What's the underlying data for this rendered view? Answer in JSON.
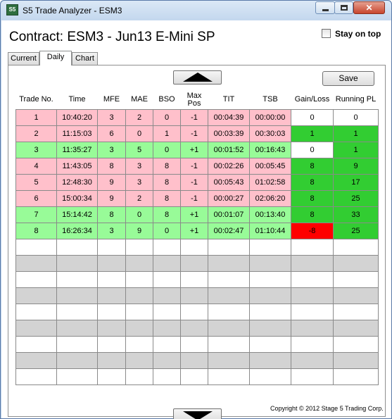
{
  "window": {
    "title": "S5 Trade Analyzer - ESM3",
    "icon_text": "S5"
  },
  "header": {
    "contract_label": "Contract: ESM3 - Jun13 E-Mini SP",
    "stay_on_top_label": "Stay on top",
    "stay_on_top_checked": false
  },
  "tabs": [
    {
      "label": "Current",
      "active": false
    },
    {
      "label": "Daily",
      "active": true
    },
    {
      "label": "Chart",
      "active": false
    }
  ],
  "toolbar": {
    "save_label": "Save",
    "scroll_up_icon": "triangle-up-icon",
    "scroll_down_icon": "triangle-down-icon"
  },
  "table": {
    "columns": [
      "Trade No.",
      "Time",
      "MFE",
      "MAE",
      "BSO",
      "Max\nPos",
      "TIT",
      "TSB",
      "Gain/Loss",
      "Running PL"
    ],
    "rows": [
      {
        "status": "red",
        "cells": [
          "1",
          "10:40:20",
          "3",
          "2",
          "0",
          "-1",
          "00:04:39",
          "00:00:00",
          "0",
          "0"
        ],
        "gain_color": "white",
        "pl_color": "white"
      },
      {
        "status": "red",
        "cells": [
          "2",
          "11:15:03",
          "6",
          "0",
          "1",
          "-1",
          "00:03:39",
          "00:30:03",
          "1",
          "1"
        ],
        "gain_color": "green",
        "pl_color": "green"
      },
      {
        "status": "green",
        "cells": [
          "3",
          "11:35:27",
          "3",
          "5",
          "0",
          "+1",
          "00:01:52",
          "00:16:43",
          "0",
          "1"
        ],
        "gain_color": "white",
        "pl_color": "green"
      },
      {
        "status": "red",
        "cells": [
          "4",
          "11:43:05",
          "8",
          "3",
          "8",
          "-1",
          "00:02:26",
          "00:05:45",
          "8",
          "9"
        ],
        "gain_color": "green",
        "pl_color": "green"
      },
      {
        "status": "red",
        "cells": [
          "5",
          "12:48:30",
          "9",
          "3",
          "8",
          "-1",
          "00:05:43",
          "01:02:58",
          "8",
          "17"
        ],
        "gain_color": "green",
        "pl_color": "green"
      },
      {
        "status": "red",
        "cells": [
          "6",
          "15:00:34",
          "9",
          "2",
          "8",
          "-1",
          "00:00:27",
          "02:06:20",
          "8",
          "25"
        ],
        "gain_color": "green",
        "pl_color": "green"
      },
      {
        "status": "green",
        "cells": [
          "7",
          "15:14:42",
          "8",
          "0",
          "8",
          "+1",
          "00:01:07",
          "00:13:40",
          "8",
          "33"
        ],
        "gain_color": "green",
        "pl_color": "green"
      },
      {
        "status": "green",
        "cells": [
          "8",
          "16:26:34",
          "3",
          "9",
          "0",
          "+1",
          "00:02:47",
          "01:10:44",
          "-8",
          "25"
        ],
        "gain_color": "red",
        "pl_color": "green"
      }
    ],
    "empty_rows": 9
  },
  "footer": {
    "copyright": "Copyright © 2012 Stage 5 Trading Corp."
  },
  "colors": {
    "row_red": "#ffc0cb",
    "row_green": "#98fb98",
    "cell_green": "#32cd32",
    "cell_red": "#ff0000",
    "empty_gray": "#d3d3d3"
  }
}
